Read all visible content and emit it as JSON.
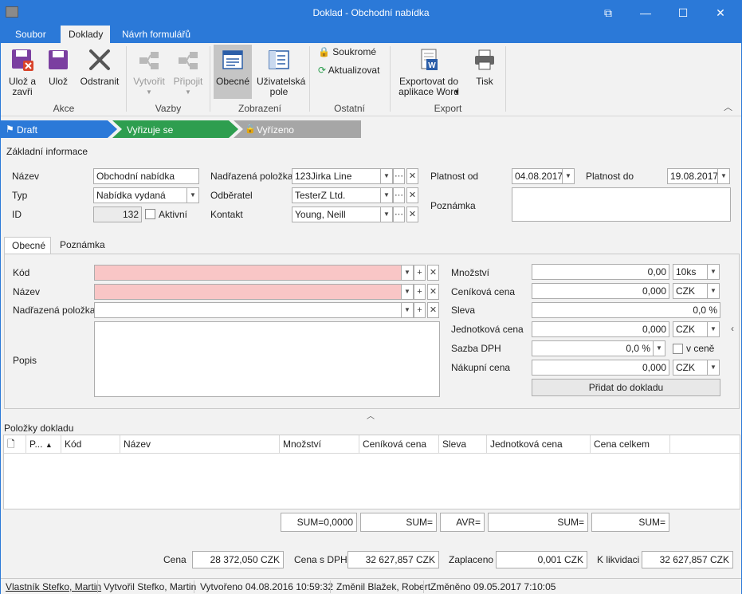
{
  "window": {
    "title": "Doklad - Obchodní nabídka"
  },
  "ribbon_tabs": [
    "Soubor",
    "Doklady",
    "Návrh formulářů"
  ],
  "ribbon": {
    "save_close": "Ulož a zavři",
    "save": "Ulož",
    "delete": "Odstranit",
    "group_akce": "Akce",
    "create": "Vytvořit",
    "attach": "Připojit",
    "group_vazby": "Vazby",
    "general": "Obecné",
    "user_fields": "Uživatelská pole",
    "group_zobrazeni": "Zobrazení",
    "private": "Soukromé",
    "refresh": "Aktualizovat",
    "group_ostatni": "Ostatní",
    "export_word": "Exportovat do aplikace Word",
    "print": "Tisk",
    "group_export": "Export"
  },
  "workflow": [
    "Draft",
    "Vyřizuje se",
    "Vyřízeno"
  ],
  "basic": {
    "section_title": "Základní informace",
    "name_label": "Název",
    "name_value": "Obchodní nabídka",
    "type_label": "Typ",
    "type_value": "Nabídka vydaná",
    "id_label": "ID",
    "id_value": "132",
    "active_label": "Aktivní",
    "parent_label": "Nadřazená položka",
    "parent_value": "123Jirka Line",
    "customer_label": "Odběratel",
    "customer_value": "TesterZ Ltd.",
    "contact_label": "Kontakt",
    "contact_value": "Young, Neill",
    "valid_from_label": "Platnost od",
    "valid_from_value": "04.08.2017",
    "valid_to_label": "Platnost do",
    "valid_to_value": "19.08.2017",
    "note_label": "Poznámka"
  },
  "panel_tabs": [
    "Obecné",
    "Poznámka"
  ],
  "item_form": {
    "code_label": "Kód",
    "name_label": "Název",
    "parent_label": "Nadřazená položka",
    "desc_label": "Popis",
    "qty_label": "Množství",
    "qty_value": "0,00",
    "qty_unit": "10ks",
    "list_price_label": "Ceníková cena",
    "list_price_value": "0,000",
    "list_price_currency": "CZK",
    "discount_label": "Sleva",
    "discount_value": "0,0 %",
    "unit_price_label": "Jednotková cena",
    "unit_price_value": "0,000",
    "unit_price_currency": "CZK",
    "vat_label": "Sazba DPH",
    "vat_value": "0,0 %",
    "vat_incl_label": "v ceně",
    "purchase_label": "Nákupní cena",
    "purchase_value": "0,000",
    "purchase_currency": "CZK",
    "add_button": "Přidat do dokladu"
  },
  "items": {
    "title": "Položky dokladu",
    "columns": [
      "P...",
      "Kód",
      "Název",
      "Množství",
      "Ceníková cena",
      "Sleva",
      "Jednotková cena",
      "Cena celkem"
    ],
    "sums": [
      "SUM=0,0000",
      "SUM=",
      "AVR=",
      "SUM=",
      "SUM="
    ]
  },
  "totals": {
    "price_label": "Cena",
    "price_value": "28 372,050 CZK",
    "price_vat_label": "Cena s DPH",
    "price_vat_value": "32 627,857 CZK",
    "paid_label": "Zaplaceno",
    "paid_value": "0,001 CZK",
    "to_pay_label": "K likvidaci",
    "to_pay_value": "32 627,857 CZK"
  },
  "status": {
    "owner": "Vlastník Stefko, Martin",
    "created_by": "Vytvořil Stefko, Martin",
    "created_at": "Vytvořeno 04.08.2016 10:59:32",
    "changed_by": "Změnil Blažek, Robert",
    "changed_at": "Změněno 09.05.2017 7:10:05"
  },
  "colors": {
    "accent": "#2b79d8",
    "draft": "#2b79d8",
    "in_progress": "#2e9e4f",
    "done": "#a6a6a6",
    "required": "#f9c6c6"
  }
}
